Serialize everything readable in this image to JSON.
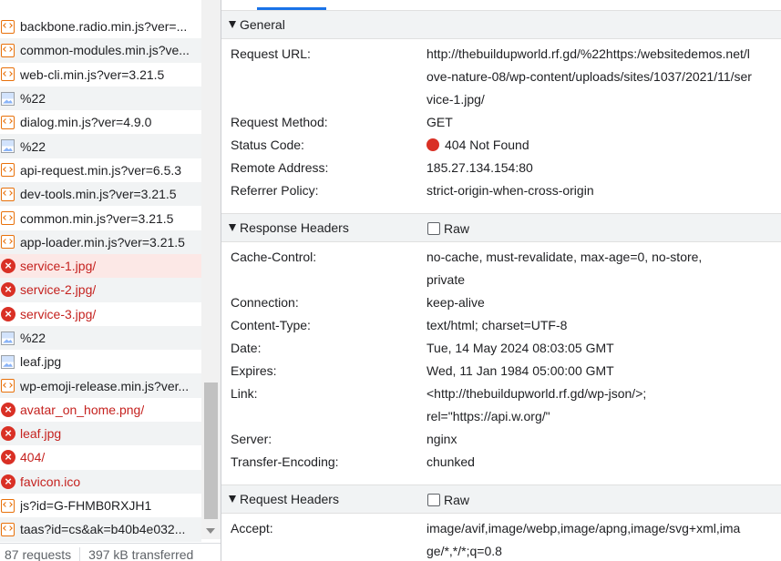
{
  "request_list": [
    {
      "name": "backbone.radio.min.js?ver=...",
      "icon": "script-icon",
      "error": false
    },
    {
      "name": "common-modules.min.js?ve...",
      "icon": "script-icon",
      "error": false
    },
    {
      "name": "web-cli.min.js?ver=3.21.5",
      "icon": "script-icon",
      "error": false
    },
    {
      "name": "%22",
      "icon": "image-icon",
      "error": false
    },
    {
      "name": "dialog.min.js?ver=4.9.0",
      "icon": "script-icon",
      "error": false
    },
    {
      "name": "%22",
      "icon": "image-icon",
      "error": false
    },
    {
      "name": "api-request.min.js?ver=6.5.3",
      "icon": "script-icon",
      "error": false
    },
    {
      "name": "dev-tools.min.js?ver=3.21.5",
      "icon": "script-icon",
      "error": false
    },
    {
      "name": "common.min.js?ver=3.21.5",
      "icon": "script-icon",
      "error": false
    },
    {
      "name": "app-loader.min.js?ver=3.21.5",
      "icon": "script-icon",
      "error": false
    },
    {
      "name": "service-1.jpg/",
      "icon": "error-icon",
      "error": true,
      "selected": true
    },
    {
      "name": "service-2.jpg/",
      "icon": "error-icon",
      "error": true
    },
    {
      "name": "service-3.jpg/",
      "icon": "error-icon",
      "error": true
    },
    {
      "name": "%22",
      "icon": "image-icon",
      "error": false
    },
    {
      "name": "leaf.jpg",
      "icon": "image-icon",
      "error": false
    },
    {
      "name": "wp-emoji-release.min.js?ver...",
      "icon": "script-icon",
      "error": false
    },
    {
      "name": "avatar_on_home.png/",
      "icon": "error-icon",
      "error": true
    },
    {
      "name": "leaf.jpg",
      "icon": "error-icon",
      "error": true
    },
    {
      "name": "404/",
      "icon": "error-icon",
      "error": true
    },
    {
      "name": "favicon.ico",
      "icon": "error-icon",
      "error": true
    },
    {
      "name": "js?id=G-FHMB0RXJH1",
      "icon": "script-icon",
      "error": false
    },
    {
      "name": "taas?id=cs&ak=b40b4e032...",
      "icon": "script-icon",
      "error": false
    }
  ],
  "status_bar": {
    "requests": "87 requests",
    "transferred": "397 kB transferred"
  },
  "general": {
    "title": "General",
    "request_url_label": "Request URL:",
    "request_url_lines": [
      "http://thebuildupworld.rf.gd/%22https:/websitedemos.net/l",
      "ove-nature-08/wp-content/uploads/sites/1037/2021/11/ser",
      "vice-1.jpg/"
    ],
    "request_method_label": "Request Method:",
    "request_method": "GET",
    "status_code_label": "Status Code:",
    "status_code": "404 Not Found",
    "status_color": "#d93025",
    "remote_address_label": "Remote Address:",
    "remote_address": "185.27.134.154:80",
    "referrer_policy_label": "Referrer Policy:",
    "referrer_policy": "strict-origin-when-cross-origin"
  },
  "response_headers": {
    "title": "Response Headers",
    "raw_label": "Raw",
    "raw_checked": false,
    "items": [
      {
        "key": "Cache-Control:",
        "lines": [
          "no-cache, must-revalidate, max-age=0, no-store,",
          "private"
        ]
      },
      {
        "key": "Connection:",
        "lines": [
          "keep-alive"
        ]
      },
      {
        "key": "Content-Type:",
        "lines": [
          "text/html; charset=UTF-8"
        ]
      },
      {
        "key": "Date:",
        "lines": [
          "Tue, 14 May 2024 08:03:05 GMT"
        ]
      },
      {
        "key": "Expires:",
        "lines": [
          "Wed, 11 Jan 1984 05:00:00 GMT"
        ]
      },
      {
        "key": "Link:",
        "lines": [
          "<http://thebuildupworld.rf.gd/wp-json/>;",
          "rel=\"https://api.w.org/\""
        ]
      },
      {
        "key": "Server:",
        "lines": [
          "nginx"
        ]
      },
      {
        "key": "Transfer-Encoding:",
        "lines": [
          "chunked"
        ]
      }
    ]
  },
  "request_headers": {
    "title": "Request Headers",
    "raw_label": "Raw",
    "raw_checked": false,
    "items": [
      {
        "key": "Accept:",
        "lines": [
          "image/avif,image/webp,image/apng,image/svg+xml,ima",
          "ge/*,*/*;q=0.8"
        ]
      }
    ]
  }
}
